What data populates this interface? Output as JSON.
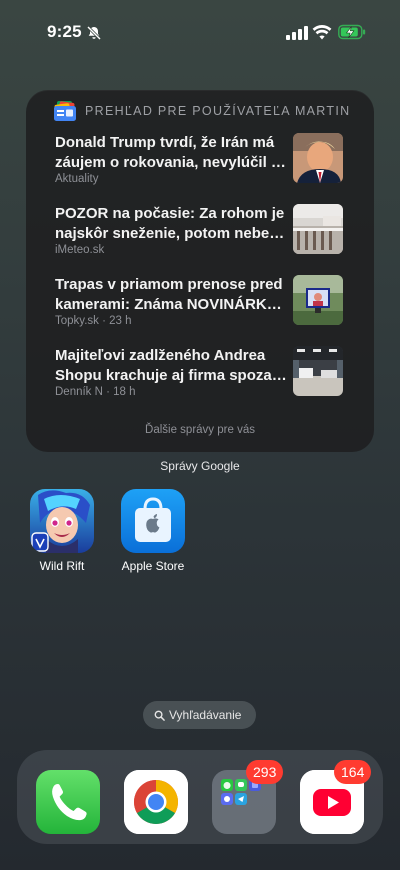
{
  "status": {
    "time": "9:25"
  },
  "widget": {
    "title": "PREHĽAD PRE POUŽÍVATEĽA MARTIN",
    "items": [
      {
        "line1": "Donald Trump tvrdí, že Irán má",
        "line2": "záujem o rokovania, nevylúčil pre...",
        "source": "Aktuality"
      },
      {
        "line1": "POZOR na počasie: Za rohom je",
        "line2": "najskôr sneženie, potom nebezp...",
        "source": "iMeteo.sk"
      },
      {
        "line1": "Trapas v priamom prenose pred",
        "line2": "kamerami: Známa NOVINÁRKA v...",
        "source": "Topky.sk · 23 h"
      },
      {
        "line1": "Majiteľovi zadlženého Andrea",
        "line2": "Shopu krachuje aj firma spoza pr...",
        "source": "Denník N · 18 h"
      }
    ],
    "more": "Ďalšie správy pre vás",
    "label": "Správy Google"
  },
  "apps": [
    {
      "label": "Wild Rift"
    },
    {
      "label": "Apple Store"
    }
  ],
  "search": {
    "label": "Vyhľadávanie"
  },
  "dock": {
    "badges": {
      "folder": "293",
      "youtube": "164"
    }
  }
}
